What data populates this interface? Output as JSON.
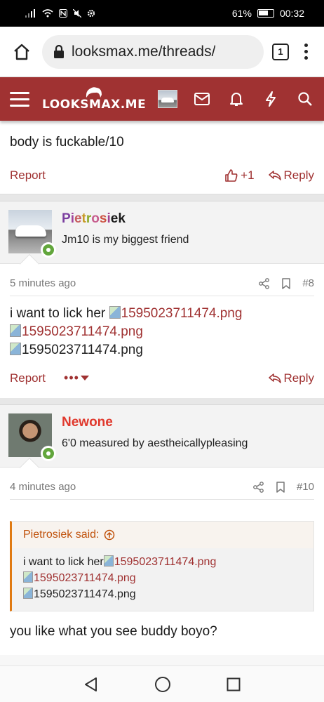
{
  "status_bar": {
    "battery": "61%",
    "time": "00:32"
  },
  "browser": {
    "url": "looksmax.me/threads/",
    "tab_count": "1"
  },
  "site": {
    "logo_text": "LOOKSMAX.ME"
  },
  "post_tail": {
    "text": "body is fuckable/10",
    "report": "Report",
    "like_count": "+1",
    "reply": "Reply"
  },
  "post_8": {
    "username_chars": [
      "P",
      "i",
      "e",
      "t",
      "r",
      "o",
      "s",
      "i",
      "e",
      "k"
    ],
    "user_title": "Jm10 is my biggest friend",
    "time": "5 minutes ago",
    "number": "#8",
    "body_prefix": "i want to lick her ",
    "img1": "1595023711474.png",
    "img2": "1595023711474.png",
    "img3": "1595023711474.png",
    "report": "Report",
    "more": "•••",
    "reply": "Reply"
  },
  "post_10": {
    "username": "Newone",
    "user_title": "6'0 measured by aestheicallypleasing",
    "time": "4 minutes ago",
    "number": "#10",
    "quote_author": "Pietrosiek said:",
    "quote_prefix": "i want to lick her",
    "quote_img1": "1595023711474.png",
    "quote_img2": "1595023711474.png",
    "quote_img3": "1595023711474.png",
    "body": "you like what you see buddy boyo?"
  },
  "colors": {
    "brand": "#a03232",
    "quote_accent": "#e07a12",
    "online": "#62a63c"
  }
}
